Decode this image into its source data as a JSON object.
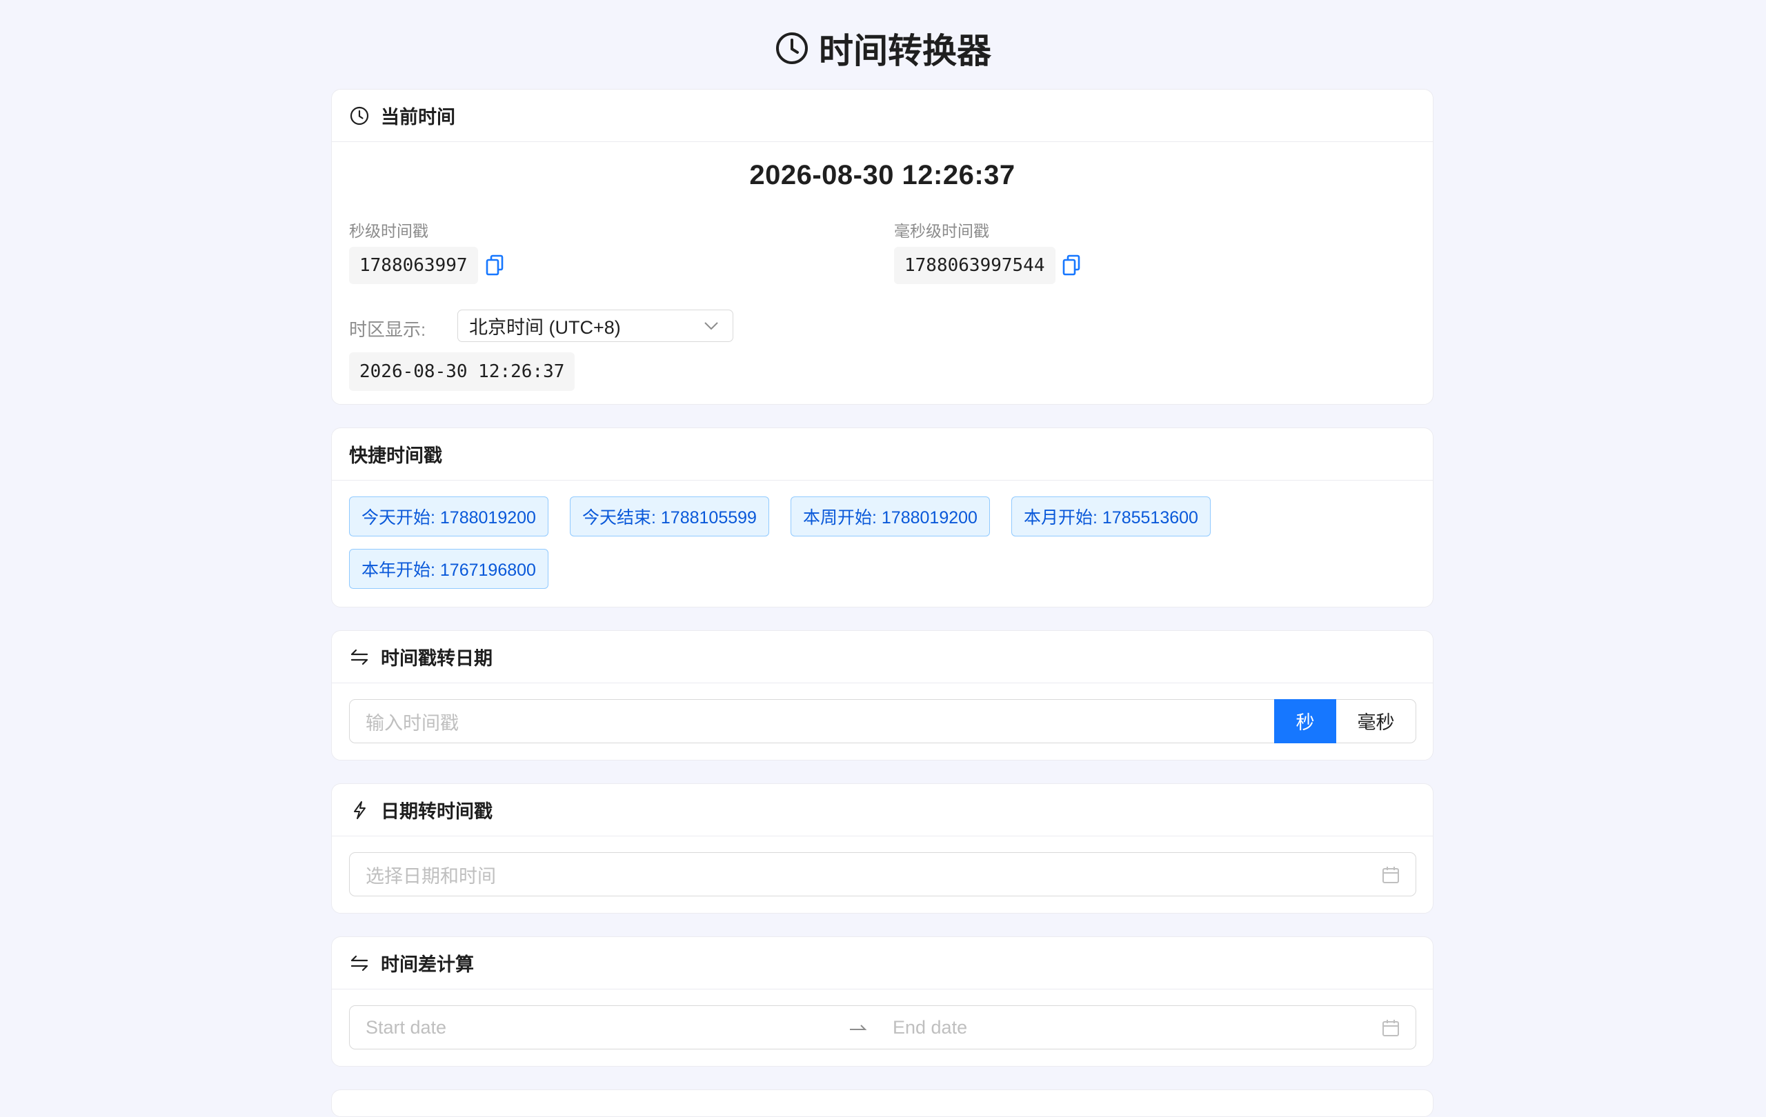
{
  "title": "时间转换器",
  "current_time": {
    "header": "当前时间",
    "datetime": "2026-08-30 12:26:37",
    "seconds_label": "秒级时间戳",
    "seconds_value": "1788063997",
    "millis_label": "毫秒级时间戳",
    "millis_value": "1788063997544",
    "timezone_label": "时区显示:",
    "timezone_selected": "北京时间 (UTC+8)",
    "timezone_time": "2026-08-30 12:26:37"
  },
  "quick": {
    "header": "快捷时间戳",
    "tags": [
      "今天开始: 1788019200",
      "今天结束: 1788105599",
      "本周开始: 1788019200",
      "本月开始: 1785513600",
      "本年开始: 1767196800"
    ]
  },
  "ts_to_date": {
    "header": "时间戳转日期",
    "placeholder": "输入时间戳",
    "unit_seconds": "秒",
    "unit_millis": "毫秒"
  },
  "date_to_ts": {
    "header": "日期转时间戳",
    "placeholder": "选择日期和时间"
  },
  "diff": {
    "header": "时间差计算",
    "start_placeholder": "Start date",
    "end_placeholder": "End date"
  },
  "colors": {
    "primary": "#1677ff",
    "tag_bg": "#e6f4ff",
    "tag_border": "#91caff",
    "page_bg": "#f4f5fd"
  },
  "icons": [
    "clock-icon",
    "copy-icon",
    "chevron-down-icon",
    "swap-icon",
    "thunderbolt-icon",
    "calendar-icon",
    "arrow-right-icon"
  ]
}
